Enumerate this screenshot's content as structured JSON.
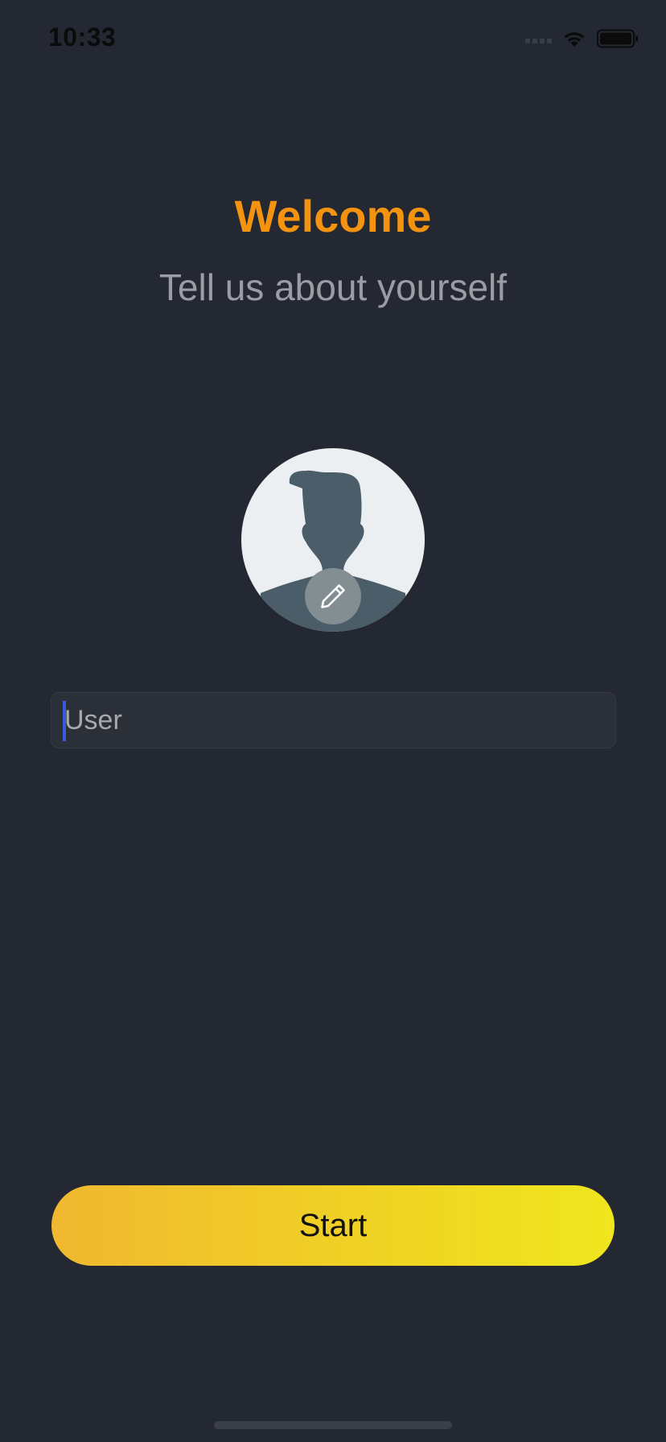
{
  "status_bar": {
    "time": "10:33"
  },
  "welcome": {
    "title": "Welcome",
    "subtitle": "Tell us about yourself"
  },
  "profile": {
    "avatar_icon": "person-silhouette-icon",
    "edit_icon": "pencil-icon"
  },
  "form": {
    "name_value": "",
    "name_placeholder": "User"
  },
  "actions": {
    "start_label": "Start"
  },
  "colors": {
    "background": "#242832",
    "title": "#f4930f",
    "subtitle": "#9a9da3",
    "button_gradient_start": "#f0b830",
    "button_gradient_end": "#efe61e",
    "caret": "#3a5bd9"
  }
}
